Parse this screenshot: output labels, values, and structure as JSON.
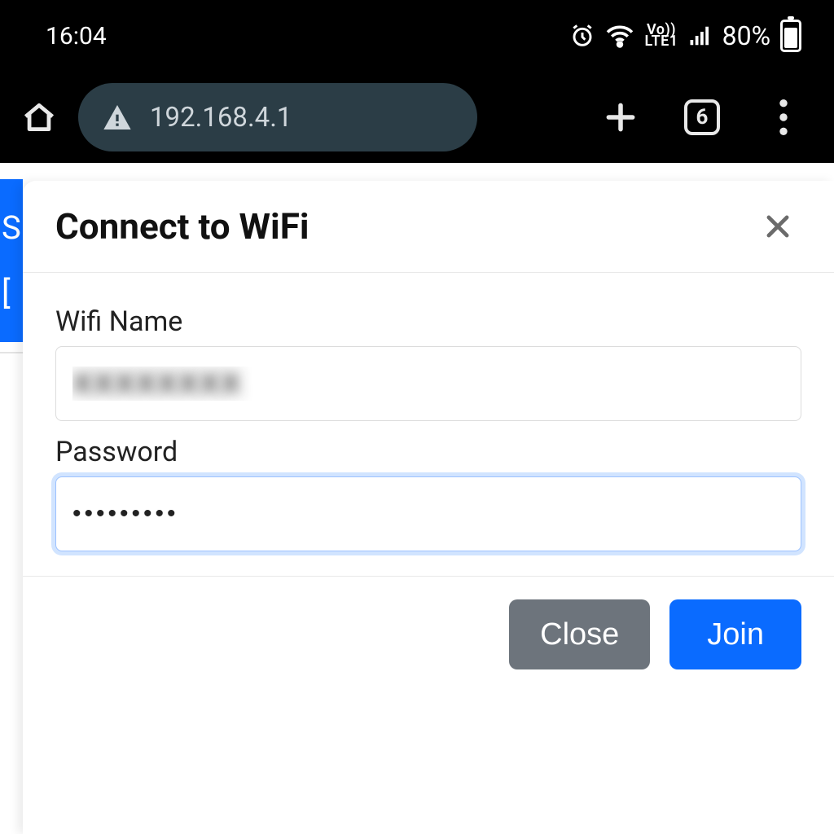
{
  "status": {
    "time": "16:04",
    "volte_top": "Vo))",
    "volte_bottom": "LTE1",
    "battery": "80%"
  },
  "browser": {
    "url": "192.168.4.1",
    "tabs_count": "6"
  },
  "modal": {
    "title": "Connect to WiFi",
    "wifi_label": "Wifi Name",
    "wifi_value": "XXXXXXXX",
    "password_label": "Password",
    "password_value": "•••••••••",
    "close_label": "Close",
    "join_label": "Join"
  }
}
